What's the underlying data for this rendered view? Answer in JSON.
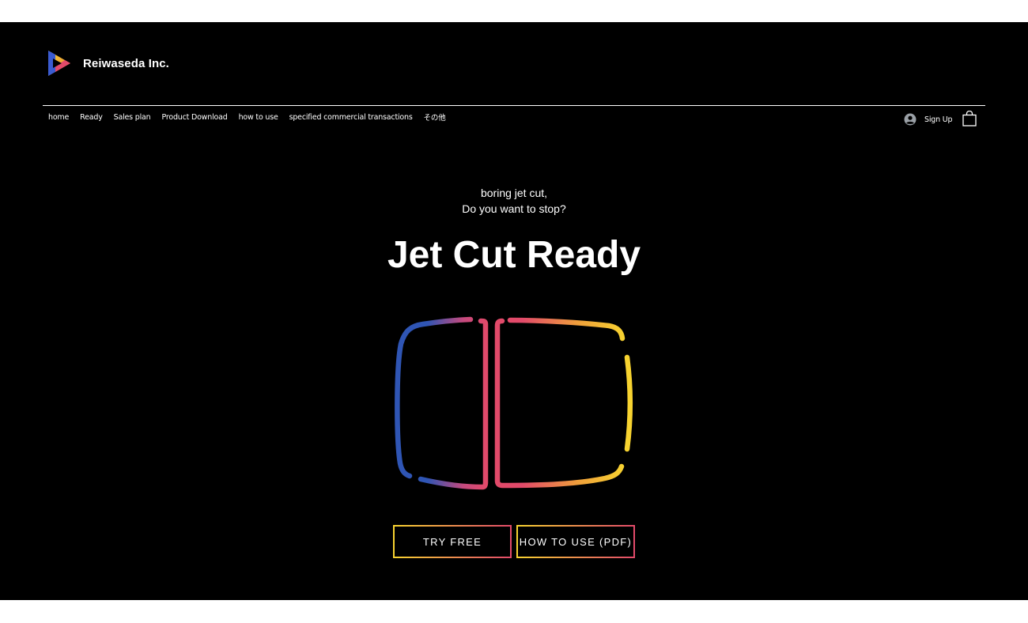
{
  "brand": {
    "name": "Reiwaseda Inc.",
    "logo_icon": "play-triangle-logo-icon"
  },
  "nav": {
    "items": [
      {
        "label": "home"
      },
      {
        "label": "Ready"
      },
      {
        "label": "Sales plan"
      },
      {
        "label": "Product Download"
      },
      {
        "label": "how to use"
      },
      {
        "label": "specified commercial transactions"
      },
      {
        "label": "その他"
      }
    ]
  },
  "account": {
    "sign_up_label": "Sign Up",
    "icon": "user-avatar-icon"
  },
  "cart": {
    "icon": "shopping-bag-icon"
  },
  "hero": {
    "kicker_line1": "boring jet cut,",
    "kicker_line2": "Do you want to stop?",
    "title": "Jet Cut Ready",
    "graphic_icon": "split-frame-gradient-icon"
  },
  "buttons": {
    "try_free": "TRY FREE",
    "how_to_use_pdf": "HOW TO USE (PDF)"
  },
  "colors": {
    "background": "#000000",
    "text": "#ffffff",
    "gradient_blue": "#2f55b4",
    "gradient_pink": "#e24a6a",
    "gradient_yellow": "#f7d330"
  }
}
